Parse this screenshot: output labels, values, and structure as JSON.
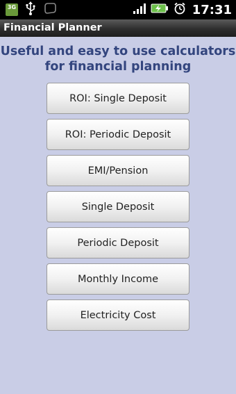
{
  "status_bar": {
    "network_badge": "3G",
    "time": "17:31",
    "icons": [
      "3g-icon",
      "usb-icon",
      "notification-icon",
      "signal-icon",
      "battery-charging-icon",
      "alarm-clock-icon"
    ]
  },
  "app": {
    "title": "Financial Planner"
  },
  "main": {
    "heading": "Useful and easy to use calculators for financial planning",
    "buttons": [
      {
        "id": "roi-single-deposit",
        "label": "ROI: Single Deposit"
      },
      {
        "id": "roi-periodic-deposit",
        "label": "ROI: Periodic Deposit"
      },
      {
        "id": "emi-pension",
        "label": "EMI/Pension"
      },
      {
        "id": "single-deposit",
        "label": "Single Deposit"
      },
      {
        "id": "periodic-deposit",
        "label": "Periodic Deposit"
      },
      {
        "id": "monthly-income",
        "label": "Monthly Income"
      },
      {
        "id": "electricity-cost",
        "label": "Electricity Cost"
      }
    ]
  },
  "colors": {
    "background": "#c9cde6",
    "heading": "#33457e",
    "battery": "#6cc04a"
  }
}
